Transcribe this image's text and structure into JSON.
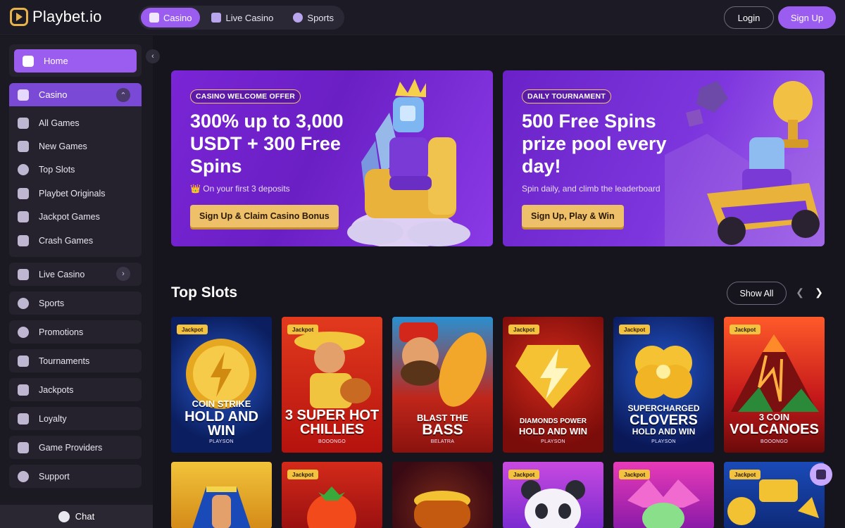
{
  "brand": {
    "name": "Playbet.io"
  },
  "header": {
    "tabs": [
      {
        "label": "Casino",
        "icon": "casino-icon"
      },
      {
        "label": "Live Casino",
        "icon": "live-dealer-icon"
      },
      {
        "label": "Sports",
        "icon": "sports-ball-icon"
      }
    ],
    "login_label": "Login",
    "signup_label": "Sign Up"
  },
  "sidebar": {
    "home": "Home",
    "casino": {
      "label": "Casino",
      "items": [
        {
          "label": "All Games",
          "icon": "all-games-icon"
        },
        {
          "label": "New Games",
          "icon": "lightning-icon"
        },
        {
          "label": "Top Slots",
          "icon": "cherry-icon"
        },
        {
          "label": "Playbet Originals",
          "icon": "playbet-logo-icon"
        },
        {
          "label": "Jackpot Games",
          "icon": "jackpot-icon"
        },
        {
          "label": "Crash Games",
          "icon": "rocket-icon"
        }
      ]
    },
    "items": [
      {
        "label": "Live Casino",
        "icon": "live-dealer-icon"
      },
      {
        "label": "Sports",
        "icon": "sports-ball-icon"
      },
      {
        "label": "Promotions",
        "icon": "percent-icon"
      },
      {
        "label": "Tournaments",
        "icon": "trophy-icon"
      },
      {
        "label": "Jackpots",
        "icon": "jackpot-icon"
      },
      {
        "label": "Loyalty",
        "icon": "loyalty-icon"
      },
      {
        "label": "Game Providers",
        "icon": "providers-icon"
      },
      {
        "label": "Support",
        "icon": "support-icon"
      }
    ],
    "chat": "Chat"
  },
  "banners": [
    {
      "pill": "CASINO WELCOME OFFER",
      "title": "300% up to 3,000 USDT + 300 Free Spins",
      "subtitle": "👑 On your first 3 deposits",
      "button": "Sign Up & Claim Casino Bonus"
    },
    {
      "pill": "DAILY TOURNAMENT",
      "title": "500 Free Spins prize pool every day!",
      "subtitle": "Spin daily, and climb the leaderboard",
      "button": "Sign Up, Play & Win"
    }
  ],
  "top_slots": {
    "title": "Top Slots",
    "show_all": "Show All",
    "jackpot_badge": "Jackpot",
    "games": [
      {
        "name_l1": "COIN STRIKE",
        "name_l2": "HOLD AND",
        "name_l3": "WIN",
        "provider": "PLAYSON",
        "jackpot": true,
        "bg": "#0c2a78"
      },
      {
        "name_l1": "3 SUPER HOT",
        "name_l2": "CHILLIES",
        "name_l3": "",
        "provider": "BOOONGO",
        "jackpot": true,
        "bg": "#c21a1a"
      },
      {
        "name_l1": "BLAST THE",
        "name_l2": "BASS",
        "name_l3": "",
        "provider": "BELATRA",
        "jackpot": false,
        "bg": "#b22014"
      },
      {
        "name_l1": "DIAMONDS POWER",
        "name_l2": "HOLD AND WIN",
        "name_l3": "",
        "provider": "PLAYSON",
        "jackpot": true,
        "bg": "#a0140f"
      },
      {
        "name_l1": "SUPERCHARGED",
        "name_l2": "CLOVERS",
        "name_l3": "HOLD AND WIN",
        "provider": "PLAYSON",
        "jackpot": true,
        "bg": "#0d1e6a"
      },
      {
        "name_l1": "3 COIN",
        "name_l2": "VOLCANOES",
        "name_l3": "",
        "provider": "BOOONGO",
        "jackpot": true,
        "bg": "#c0201a"
      }
    ],
    "row2_jackpot": [
      false,
      true,
      false,
      true,
      true,
      true
    ]
  }
}
